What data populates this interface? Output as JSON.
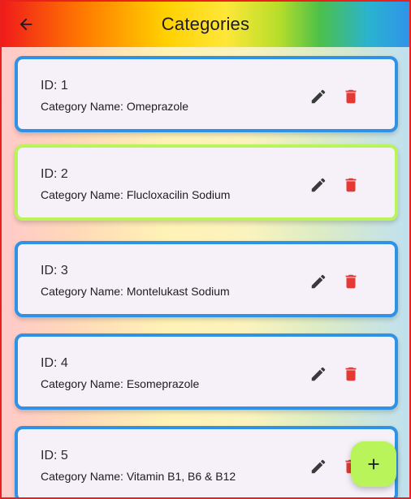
{
  "app_bar": {
    "title": "Categories",
    "back_icon": "arrow-back-icon",
    "gradient_colors": [
      "#f01b1b",
      "#ff7a00",
      "#ffd000",
      "#ffe739",
      "#4cc04a",
      "#2f93e8"
    ]
  },
  "categories": [
    {
      "id_label": "ID: 1",
      "name_label": "Category Name: Omeprazole",
      "border_color": "#2f92e6"
    },
    {
      "id_label": "ID: 2",
      "name_label": "Category Name: Flucloxacilin Sodium",
      "border_color": "#b9f55a"
    },
    {
      "id_label": "ID: 3",
      "name_label": "Category Name: Montelukast Sodium",
      "border_color": "#2f92e6"
    },
    {
      "id_label": "ID: 4",
      "name_label": "Category Name: Esomeprazole",
      "border_color": "#2f92e6"
    },
    {
      "id_label": "ID: 5",
      "name_label": "Category Name: Vitamin B1, B6 & B12",
      "border_color": "#2f92e6"
    }
  ],
  "actions": {
    "edit_icon": "pencil-icon",
    "delete_icon": "trash-icon",
    "delete_color": "#e53935"
  },
  "fab": {
    "icon": "plus-icon",
    "color": "#b9f55a"
  }
}
